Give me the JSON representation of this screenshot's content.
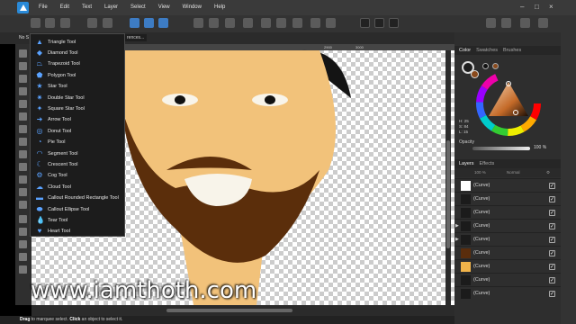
{
  "app": {
    "accent": "#2a8ad8"
  },
  "menu": [
    "File",
    "Edit",
    "Text",
    "Layer",
    "Select",
    "View",
    "Window",
    "Help"
  ],
  "context_bar": {
    "label": "No S",
    "doc_ref": "rences..."
  },
  "ruler": {
    "ticks": [
      "2900",
      "3000"
    ]
  },
  "flyout": {
    "items": [
      {
        "label": "Triangle Tool",
        "icon": "triangle-icon",
        "glyph": "▲"
      },
      {
        "label": "Diamond Tool",
        "icon": "diamond-icon",
        "glyph": "◆"
      },
      {
        "label": "Trapezoid Tool",
        "icon": "trapezoid-icon",
        "glyph": "⏢"
      },
      {
        "label": "Polygon Tool",
        "icon": "polygon-icon",
        "glyph": "⬟"
      },
      {
        "label": "Star Tool",
        "icon": "star-icon",
        "glyph": "★"
      },
      {
        "label": "Double Star Tool",
        "icon": "double-star-icon",
        "glyph": "✷"
      },
      {
        "label": "Square Star Tool",
        "icon": "square-star-icon",
        "glyph": "✦"
      },
      {
        "label": "Arrow Tool",
        "icon": "arrow-icon",
        "glyph": "➜"
      },
      {
        "label": "Donut Tool",
        "icon": "donut-icon",
        "glyph": "◎"
      },
      {
        "label": "Pie Tool",
        "icon": "pie-icon",
        "glyph": "◔"
      },
      {
        "label": "Segment Tool",
        "icon": "segment-icon",
        "glyph": "◠"
      },
      {
        "label": "Crescent Tool",
        "icon": "crescent-icon",
        "glyph": "☾"
      },
      {
        "label": "Cog Tool",
        "icon": "cog-icon",
        "glyph": "⚙"
      },
      {
        "label": "Cloud Tool",
        "icon": "cloud-icon",
        "glyph": "☁"
      },
      {
        "label": "Callout Rounded Rectangle Tool",
        "icon": "callout-rect-icon",
        "glyph": "▬"
      },
      {
        "label": "Callout Ellipse Tool",
        "icon": "callout-ellipse-icon",
        "glyph": "⬬"
      },
      {
        "label": "Tear Tool",
        "icon": "tear-icon",
        "glyph": "💧"
      },
      {
        "label": "Heart Tool",
        "icon": "heart-icon",
        "glyph": "♥"
      }
    ]
  },
  "right_panel": {
    "tabs": [
      "Color",
      "Swatches",
      "Brushes"
    ],
    "hsl": {
      "h": "H: 25",
      "s": "S: 84",
      "l": "L: 15"
    },
    "opacity_label": "Opacity",
    "opacity_value": "100 %",
    "opacity_level": 1.0,
    "layers_tabs": [
      "Layers",
      "Effects"
    ],
    "layers_opacity": "100 %",
    "layers_blend": "Normal",
    "layers": [
      {
        "name": "(Curve)",
        "thumb": "#ffffff",
        "arrow": ""
      },
      {
        "name": "(Curve)",
        "thumb": "#1b1b1b",
        "arrow": ""
      },
      {
        "name": "(Curve)",
        "thumb": "#1b1b1b",
        "arrow": ""
      },
      {
        "name": "(Curve)",
        "thumb": "#1b1b1b",
        "arrow": "▶"
      },
      {
        "name": "(Curve)",
        "thumb": "#1b1b1b",
        "arrow": "▶"
      },
      {
        "name": "(Curve)",
        "thumb": "#5a2d0c",
        "arrow": ""
      },
      {
        "name": "(Curve)",
        "thumb": "#f0b34a",
        "arrow": ""
      },
      {
        "name": "(Curve)",
        "thumb": "#1b1b1b",
        "arrow": ""
      },
      {
        "name": "(Curve)",
        "thumb": "#1b1b1b",
        "arrow": ""
      }
    ]
  },
  "status": {
    "drag": "Drag",
    "drag_text": " to marquee select. ",
    "click": "Click",
    "click_text": " an object to select it."
  },
  "watermark": "www.iamthoth.com",
  "colors": {
    "skin": "#f2c27a",
    "beard": "#5b2e0b",
    "hair": "#141414"
  }
}
